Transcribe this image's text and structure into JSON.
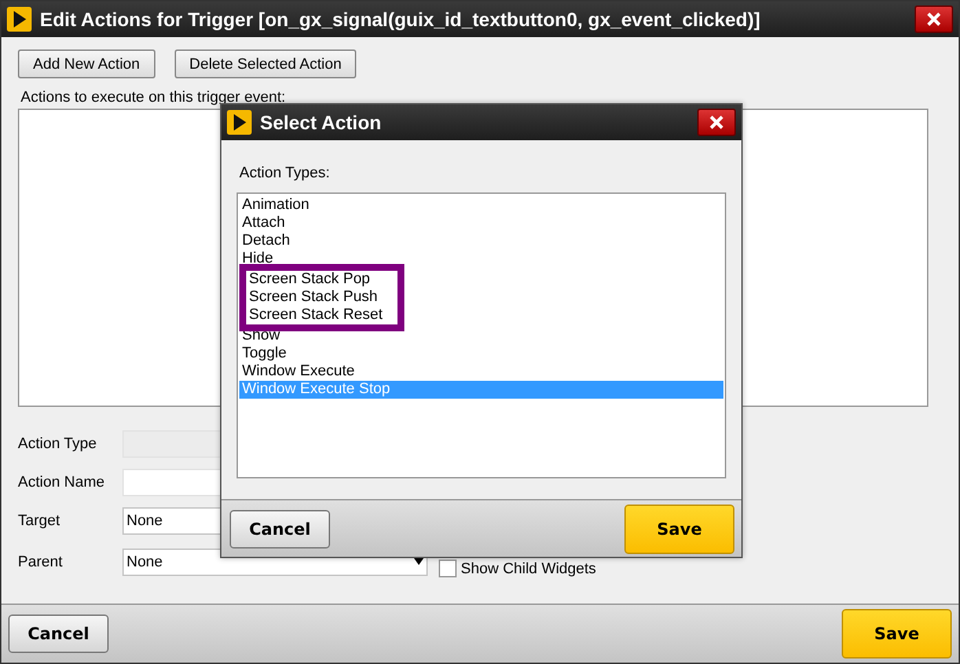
{
  "window": {
    "title": "Edit Actions for Trigger [on_gx_signal(guix_id_textbutton0, gx_event_clicked)]"
  },
  "toolbar": [
    "Add New Action",
    "Delete Selected Action"
  ],
  "actions_label": "Actions to execute on this trigger event:",
  "form": [
    {
      "label": "Action Type",
      "kind": "text",
      "disabled": true
    },
    {
      "label": "Action Name",
      "kind": "text",
      "disabled": false
    },
    {
      "label": "Target",
      "kind": "select",
      "value": "None",
      "disabled": false
    },
    {
      "label": "Parent",
      "kind": "select",
      "value": "None",
      "disabled": false
    }
  ],
  "show_child_widgets": {
    "label": "Show Child Widgets",
    "checked": false
  },
  "footer": {
    "cancel": "Cancel",
    "save": "Save"
  },
  "dialog": {
    "title": "Select Action",
    "list_label": "Action Types:",
    "items": [
      {
        "label": "Animation",
        "selected": false,
        "highlighted": false
      },
      {
        "label": "Attach",
        "selected": false,
        "highlighted": false
      },
      {
        "label": "Detach",
        "selected": false,
        "highlighted": false
      },
      {
        "label": "Hide",
        "selected": false,
        "highlighted": false
      },
      {
        "label": "Screen Stack Pop",
        "selected": false,
        "highlighted": true
      },
      {
        "label": "Screen Stack Push",
        "selected": false,
        "highlighted": true
      },
      {
        "label": "Screen Stack Reset",
        "selected": false,
        "highlighted": true
      },
      {
        "label": "Show",
        "selected": false,
        "highlighted": false
      },
      {
        "label": "Toggle",
        "selected": false,
        "highlighted": false
      },
      {
        "label": "Window Execute",
        "selected": false,
        "highlighted": false
      },
      {
        "label": "Window Execute Stop",
        "selected": true,
        "highlighted": false
      }
    ],
    "cancel": "Cancel",
    "save": "Save"
  }
}
